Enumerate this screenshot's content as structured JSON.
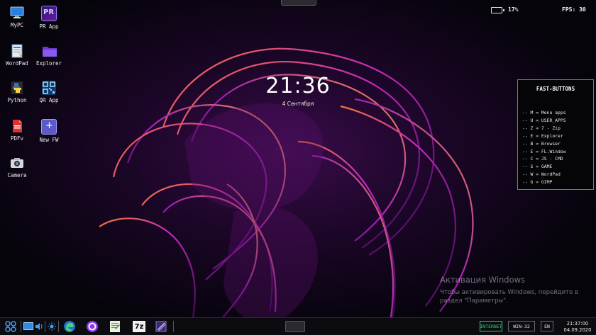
{
  "desktop": {
    "icons": [
      {
        "label": "MyPC",
        "icon": "monitor-icon"
      },
      {
        "label": "PR App",
        "icon": "pr-app-icon"
      },
      {
        "label": "WordPad",
        "icon": "wordpad-icon"
      },
      {
        "label": "Explorer",
        "icon": "folder-icon"
      },
      {
        "label": "Python",
        "icon": "python-icon"
      },
      {
        "label": "QR App",
        "icon": "qr-code-icon"
      },
      {
        "label": "PDFv",
        "icon": "pdf-icon"
      },
      {
        "label": "New FW",
        "icon": "new-window-icon"
      },
      {
        "label": "Camera",
        "icon": "camera-icon"
      }
    ]
  },
  "status": {
    "battery": "17%",
    "fps": "FPS: 30"
  },
  "lockclock": {
    "time": "21:36",
    "date": "4 Сентября"
  },
  "fast_buttons": {
    "title": "FAST-BUTTONS",
    "items": [
      "-- M = Menu apps",
      "-- U = USER_APPS",
      "-- Z = 7 - Zip",
      "-- E = Explorer",
      "-- B = Browser",
      "-- E = FL.Window",
      "-- C = JS - CMD",
      "-- S = GAME",
      "-- W = WordPad",
      "-- G = GIMP"
    ]
  },
  "activation": {
    "title": "Активация Windows",
    "line1": "Чтобы активировать Windows, перейдите в",
    "line2": "раздел \"Параметры\"."
  },
  "taskbar": {
    "seven_zip": "7z",
    "internet": "INTERNET",
    "platform": "WIN-32",
    "lang": "EN",
    "time": "21:37:00",
    "date": "04.09.2020"
  },
  "colors": {
    "accent_blue": "#2e8be0",
    "internet_green": "#33d17a",
    "wallpaper_magenta": "#c02dd0",
    "wallpaper_orange": "#ff8a3c"
  }
}
